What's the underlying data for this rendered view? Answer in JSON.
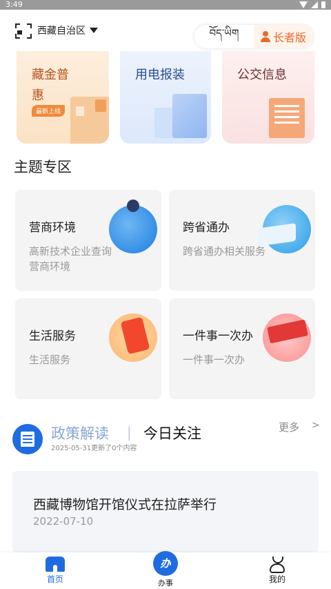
{
  "status_bar": {
    "time": "3:49"
  },
  "header": {
    "region": "西藏自治区",
    "lang_tibetan": "བོད་ཡིག",
    "lang_elder": "长者版"
  },
  "banners": [
    {
      "title": "藏金普惠",
      "badge": "最新上线"
    },
    {
      "title": "用电报装"
    },
    {
      "title": "公交信息"
    }
  ],
  "section_title": "主题专区",
  "tiles": [
    {
      "title": "营商环境",
      "desc": "高新技术企业查询营商环境"
    },
    {
      "title": "跨省通办",
      "desc": "跨省通办相关服务"
    },
    {
      "title": "生活服务",
      "desc": "生活服务"
    },
    {
      "title": "一件事一次办",
      "desc": "一件事一次办"
    }
  ],
  "news_section": {
    "tab_policy": "政策解读",
    "divider": "|",
    "tab_today": "今日关注",
    "update_note": "2025-05-31更新了0个内容",
    "more": "更多",
    "more_arrow": ">",
    "item": {
      "title": "西藏博物馆开馆仪式在拉萨举行",
      "date": "2022-07-10"
    }
  },
  "bottom_nav": {
    "home": "首页",
    "work_icon_text": "办",
    "work": "办事",
    "mine": "我的"
  },
  "colors": {
    "accent": "#1f6ce0",
    "elder": "#e9692c"
  }
}
